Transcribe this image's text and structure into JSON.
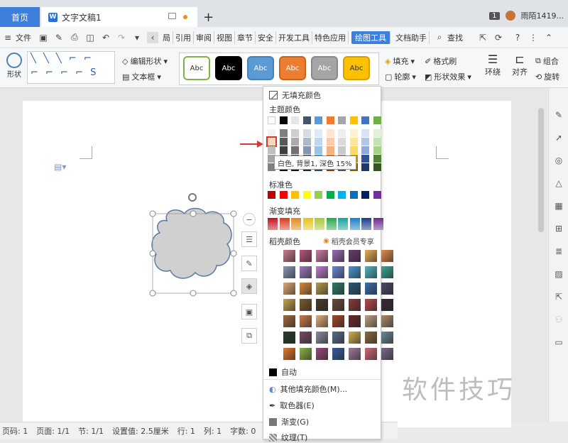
{
  "titlebar": {
    "home_tab": "首页",
    "doc_tab": "文字文稿1",
    "doc_icon": "W",
    "new_tab": "+",
    "badge": "1",
    "user": "雨陌1419..."
  },
  "menubar": {
    "file": "文件",
    "tabs": [
      "局",
      "引用",
      "审阅",
      "视图",
      "章节",
      "安全",
      "开发工具",
      "特色应用",
      "绘图工具",
      "文档助手"
    ],
    "active_tab": "绘图工具",
    "search": "查找"
  },
  "ribbon": {
    "shape_label": "形状",
    "line_glyphs_row1": "╲ ╲ ╲ ⌐ ⌐",
    "line_glyphs_row2": "⌐ ⌐ ⌐ ⌐ S",
    "edit_shape": "编辑形状",
    "textbox": "文本框",
    "style_label": "Abc",
    "style_colors": [
      "#ffffff",
      "#000000",
      "#5b9bd5",
      "#ed7d31",
      "#a5a5a5",
      "#ffc000"
    ],
    "style_borders": [
      "#7cb342",
      "#000000",
      "#4a80b8",
      "#c8651d",
      "#8a8a8a",
      "#d6a100"
    ],
    "fill": "填充",
    "format_brush": "格式刷",
    "outline": "轮廓",
    "shape_effect": "形状效果",
    "wrap": "环绕",
    "align": "对齐",
    "group": "组合",
    "rotate": "旋转"
  },
  "dropdown": {
    "no_fill": "无填充颜色",
    "theme_colors_title": "主题颜色",
    "theme_top_row": [
      "#ffffff",
      "#000000",
      "#e7e6e6",
      "#44546a",
      "#5b9bd5",
      "#ed7d31",
      "#a5a5a5",
      "#ffc000",
      "#4472c4",
      "#70ad47"
    ],
    "theme_shades": [
      [
        "#f2f2f2",
        "#7f7f7f",
        "#d0cece",
        "#d6dce4",
        "#deebf6",
        "#fbe5d5",
        "#ededed",
        "#fff2cc",
        "#dae3f3",
        "#e2efd9"
      ],
      [
        "#d8d8d8",
        "#595959",
        "#aeabab",
        "#adb9ca",
        "#bdd7ee",
        "#f7cbac",
        "#dbdbdb",
        "#fee599",
        "#b4c6e7",
        "#c5e0b3"
      ],
      [
        "#bfbfbf",
        "#3f3f3f",
        "#757070",
        "#8496b0",
        "#9cc3e5",
        "#f4b183",
        "#c9c9c9",
        "#ffd965",
        "#8eaadb",
        "#a8d08d"
      ],
      [
        "#a5a5a5",
        "#262626",
        "#3a3838",
        "#323f4f",
        "#2e75b5",
        "#c55a11",
        "#7b7b7b",
        "#bf9000",
        "#2f5496",
        "#538135"
      ],
      [
        "#7f7f7f",
        "#0c0c0c",
        "#171616",
        "#222a35",
        "#1e4e79",
        "#833c0b",
        "#525252",
        "#7f6000",
        "#1f3864",
        "#375623"
      ]
    ],
    "tooltip": "白色, 背景1, 深色 15%",
    "standard_colors_title": "标准色",
    "standard_colors": [
      "#c00000",
      "#ff0000",
      "#ffc000",
      "#ffff00",
      "#92d050",
      "#00b050",
      "#00b0f0",
      "#0070c0",
      "#002060",
      "#7030a0"
    ],
    "gradient_title": "渐变填充",
    "gradient_colors": [
      "#c0121f",
      "#d93a1d",
      "#e08a1c",
      "#e8c21a",
      "#a8c83a",
      "#2aa84a",
      "#17a39a",
      "#1b7fc4",
      "#1d3b8a",
      "#6c2a8c"
    ],
    "docer_title": "稻壳颜色",
    "docer_vip": "稻壳会员专享",
    "docer_grid": [
      [
        "#c97a8f",
        "#b5557c",
        "#d07aa8",
        "#9a6cb3",
        "#6a3b6b",
        "#e8b05a",
        "#e48b4a"
      ],
      [
        "#8a99b8",
        "#9a7abf",
        "#c27bd1",
        "#6e86d6",
        "#4a9ad2",
        "#4fb7c4",
        "#3aa796"
      ],
      [
        "#e0a870",
        "#d68b3e",
        "#b59b4b",
        "#2f7a6b",
        "#2a5a7a",
        "#3b6eab",
        "#4a4a6a"
      ],
      [
        "#c8a24a",
        "#7a5a2a",
        "#4a3a2a",
        "#6a4a3a",
        "#8a3a3a",
        "#b84a4a",
        "#3a2a3a"
      ],
      [
        "#a06a3a",
        "#c87a4a",
        "#e0b07a",
        "#a04a2a",
        "#6a2a2a",
        "#c0a080",
        "#b08a6a"
      ],
      [
        "#2a3a2a",
        "#7a4a6a",
        "#8a8aa0",
        "#5a6a8a",
        "#d0b050",
        "#8a6a3a",
        "#6a8a9a"
      ],
      [
        "#e07a2a",
        "#8ab04a",
        "#9a4a7a",
        "#3a5a9a",
        "#a07a9a",
        "#d06a7a",
        "#7a6a8a"
      ]
    ],
    "auto": "自动",
    "more_fill": "其他填充颜色(M)...",
    "eyedropper": "取色器(E)",
    "gradient": "渐变(G)",
    "texture": "纹理(T)"
  },
  "statusbar": {
    "page_num": "页码: 1",
    "pages": "页面: 1/1",
    "section": "节: 1/1",
    "setting": "设置值: 2.5厘米",
    "row": "行: 1",
    "col": "列: 1",
    "words": "字数: 0"
  },
  "watermark": "软件技巧",
  "shape": {
    "fill": "#d0d0d0",
    "stroke": "#5a7aa8"
  }
}
